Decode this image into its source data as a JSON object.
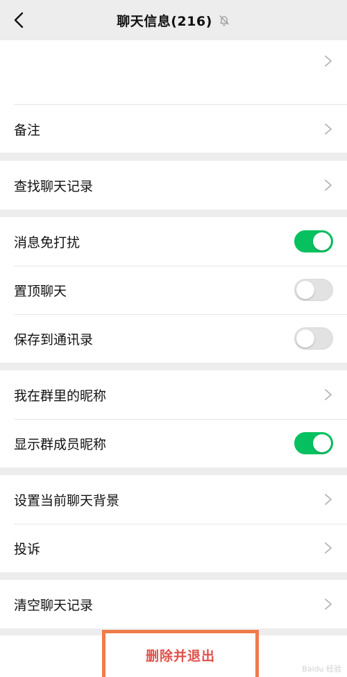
{
  "header": {
    "title": "聊天信息(216)",
    "back_icon": "chevron-left-icon",
    "mute_icon": "bell-off-icon"
  },
  "sections": [
    {
      "rows": [
        {
          "label": "备注",
          "control": "chevron"
        }
      ]
    },
    {
      "rows": [
        {
          "label": "查找聊天记录",
          "control": "chevron"
        }
      ]
    },
    {
      "rows": [
        {
          "label": "消息免打扰",
          "control": "toggle",
          "on": true
        },
        {
          "label": "置顶聊天",
          "control": "toggle",
          "on": false
        },
        {
          "label": "保存到通讯录",
          "control": "toggle",
          "on": false
        }
      ]
    },
    {
      "rows": [
        {
          "label": "我在群里的昵称",
          "control": "chevron"
        },
        {
          "label": "显示群成员昵称",
          "control": "toggle",
          "on": true
        }
      ]
    },
    {
      "rows": [
        {
          "label": "设置当前聊天背景",
          "control": "chevron"
        },
        {
          "label": "投诉",
          "control": "chevron"
        }
      ]
    },
    {
      "rows": [
        {
          "label": "清空聊天记录",
          "control": "chevron"
        }
      ]
    }
  ],
  "delete_button": {
    "label": "删除并退出"
  },
  "watermark": "Baidu 经验",
  "colors": {
    "toggle_on": "#07c160",
    "delete_text": "#e0504a",
    "highlight_box": "#f07c4a"
  }
}
